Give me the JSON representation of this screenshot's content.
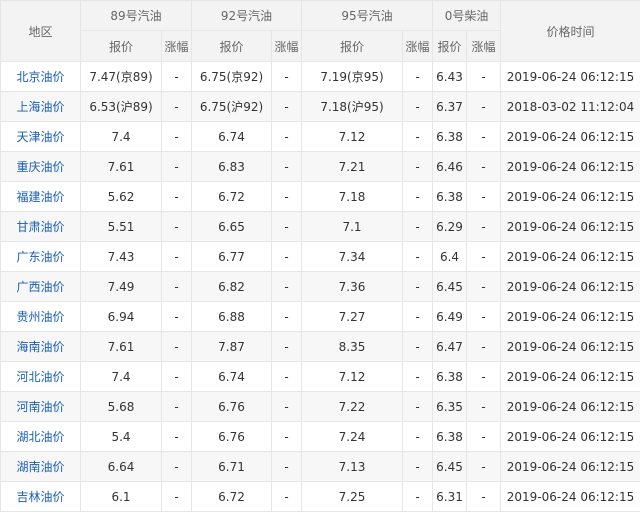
{
  "header": {
    "region": "地区",
    "groups": [
      "89号汽油",
      "92号汽油",
      "95号汽油",
      "0号柴油"
    ],
    "price_label": "报价",
    "change_label": "涨幅",
    "time_label": "价格时间"
  },
  "rows": [
    {
      "region": "北京油价",
      "p89": "7.47(京89)",
      "c89": "-",
      "p92": "6.75(京92)",
      "c92": "-",
      "p95": "7.19(京95)",
      "c95": "-",
      "p0": "6.43",
      "c0": "-",
      "time": "2019-06-24 06:12:15"
    },
    {
      "region": "上海油价",
      "p89": "6.53(沪89)",
      "c89": "-",
      "p92": "6.75(沪92)",
      "c92": "-",
      "p95": "7.18(沪95)",
      "c95": "-",
      "p0": "6.37",
      "c0": "-",
      "time": "2018-03-02 11:12:04"
    },
    {
      "region": "天津油价",
      "p89": "7.4",
      "c89": "-",
      "p92": "6.74",
      "c92": "-",
      "p95": "7.12",
      "c95": "-",
      "p0": "6.38",
      "c0": "-",
      "time": "2019-06-24 06:12:15"
    },
    {
      "region": "重庆油价",
      "p89": "7.61",
      "c89": "-",
      "p92": "6.83",
      "c92": "-",
      "p95": "7.21",
      "c95": "-",
      "p0": "6.46",
      "c0": "-",
      "time": "2019-06-24 06:12:15"
    },
    {
      "region": "福建油价",
      "p89": "5.62",
      "c89": "-",
      "p92": "6.72",
      "c92": "-",
      "p95": "7.18",
      "c95": "-",
      "p0": "6.38",
      "c0": "-",
      "time": "2019-06-24 06:12:15"
    },
    {
      "region": "甘肃油价",
      "p89": "5.51",
      "c89": "-",
      "p92": "6.65",
      "c92": "-",
      "p95": "7.1",
      "c95": "-",
      "p0": "6.29",
      "c0": "-",
      "time": "2019-06-24 06:12:15"
    },
    {
      "region": "广东油价",
      "p89": "7.43",
      "c89": "-",
      "p92": "6.77",
      "c92": "-",
      "p95": "7.34",
      "c95": "-",
      "p0": "6.4",
      "c0": "-",
      "time": "2019-06-24 06:12:15"
    },
    {
      "region": "广西油价",
      "p89": "7.49",
      "c89": "-",
      "p92": "6.82",
      "c92": "-",
      "p95": "7.36",
      "c95": "-",
      "p0": "6.45",
      "c0": "-",
      "time": "2019-06-24 06:12:15"
    },
    {
      "region": "贵州油价",
      "p89": "6.94",
      "c89": "-",
      "p92": "6.88",
      "c92": "-",
      "p95": "7.27",
      "c95": "-",
      "p0": "6.49",
      "c0": "-",
      "time": "2019-06-24 06:12:15"
    },
    {
      "region": "海南油价",
      "p89": "7.61",
      "c89": "-",
      "p92": "7.87",
      "c92": "-",
      "p95": "8.35",
      "c95": "-",
      "p0": "6.47",
      "c0": "-",
      "time": "2019-06-24 06:12:15"
    },
    {
      "region": "河北油价",
      "p89": "7.4",
      "c89": "-",
      "p92": "6.74",
      "c92": "-",
      "p95": "7.12",
      "c95": "-",
      "p0": "6.38",
      "c0": "-",
      "time": "2019-06-24 06:12:15"
    },
    {
      "region": "河南油价",
      "p89": "5.68",
      "c89": "-",
      "p92": "6.76",
      "c92": "-",
      "p95": "7.22",
      "c95": "-",
      "p0": "6.35",
      "c0": "-",
      "time": "2019-06-24 06:12:15"
    },
    {
      "region": "湖北油价",
      "p89": "5.4",
      "c89": "-",
      "p92": "6.76",
      "c92": "-",
      "p95": "7.24",
      "c95": "-",
      "p0": "6.38",
      "c0": "-",
      "time": "2019-06-24 06:12:15"
    },
    {
      "region": "湖南油价",
      "p89": "6.64",
      "c89": "-",
      "p92": "6.71",
      "c92": "-",
      "p95": "7.13",
      "c95": "-",
      "p0": "6.45",
      "c0": "-",
      "time": "2019-06-24 06:12:15"
    },
    {
      "region": "吉林油价",
      "p89": "6.1",
      "c89": "-",
      "p92": "6.72",
      "c92": "-",
      "p95": "7.25",
      "c95": "-",
      "p0": "6.31",
      "c0": "-",
      "time": "2019-06-24 06:12:15"
    }
  ],
  "colors": {
    "region_link": "#1a5fb4",
    "header_bg": "#f3f3f3",
    "stripe_bg": "#f7f7f7",
    "border": "#e6e6e6"
  }
}
